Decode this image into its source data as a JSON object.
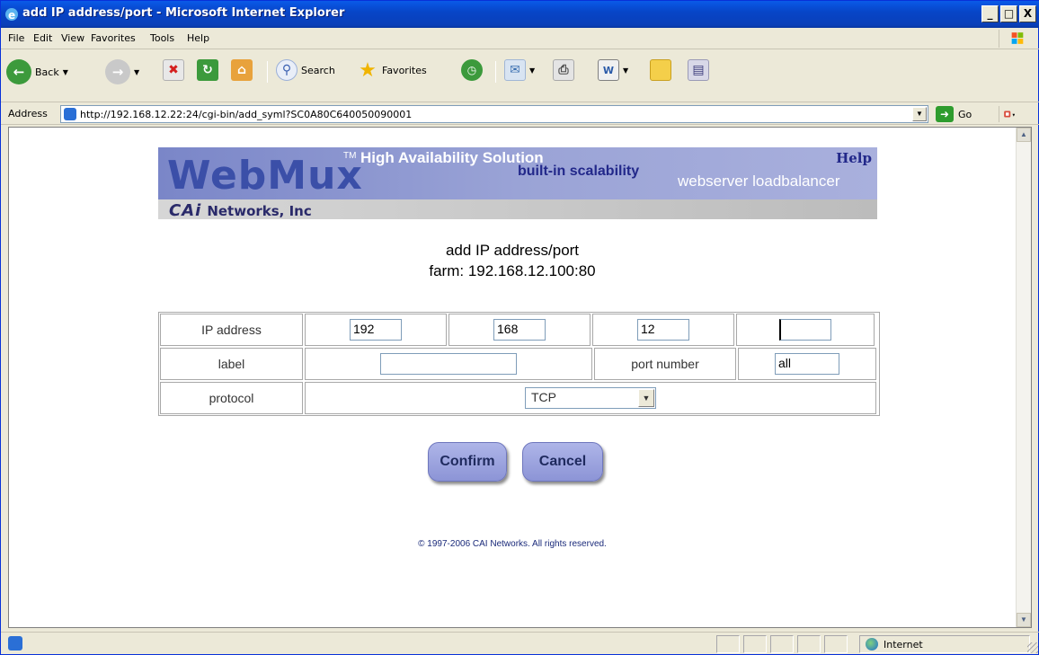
{
  "window": {
    "title": "add IP address/port - Microsoft Internet Explorer",
    "min": "_",
    "max": "□",
    "close": "X"
  },
  "menu": [
    "File",
    "Edit",
    "View",
    "Favorites",
    "Tools",
    "Help"
  ],
  "toolbar": {
    "back": "Back",
    "search": "Search",
    "favorites": "Favorites"
  },
  "address": {
    "label": "Address",
    "url": "http://192.168.12.22:24/cgi-bin/add_syml?SC0A80C640050090001",
    "go": "Go"
  },
  "banner": {
    "logo": "WebMux",
    "tm": "TM",
    "tagline": "High Availability Solution",
    "builtin": "built-in scalability",
    "subtitle": "webserver loadbalancer",
    "help": "Help",
    "company_mark": "CAi",
    "company_name": "Networks, Inc"
  },
  "heading": {
    "line1": "add IP address/port",
    "line2": "farm: 192.168.12.100:80"
  },
  "form": {
    "ip_label": "IP address",
    "ip_octets": [
      "192",
      "168",
      "12",
      ""
    ],
    "label_label": "label",
    "label_value": "",
    "port_label": "port number",
    "port_value": "all",
    "protocol_label": "protocol",
    "protocol_value": "TCP"
  },
  "buttons": {
    "confirm": "Confirm",
    "cancel": "Cancel"
  },
  "footer": {
    "copyright": "© 1997-2006 CAI Networks. All rights reserved."
  },
  "status": {
    "zone": "Internet"
  }
}
